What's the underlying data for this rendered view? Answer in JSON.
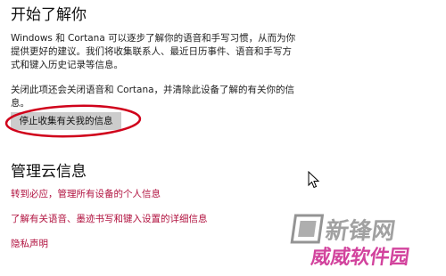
{
  "get_to_know": {
    "title": "开始了解你",
    "description": "Windows 和 Cortana 可以逐步了解你的语音和手写习惯，从而为你提供更好的建议。我们将收集联系人、最近日历事件、语音和手写方式和键入历史记录等信息。",
    "off_note": "关闭此项还会关闭语音和 Cortana，并清除此设备了解的有关你的信息。",
    "stop_button_label": "停止收集有关我的信息"
  },
  "cloud_info": {
    "title": "管理云信息",
    "links": [
      "转到必应，管理所有设备的个人信息",
      "了解有关语音、墨迹书写和键入设置的详细信息",
      "隐私声明"
    ]
  },
  "watermark": {
    "text": "新锋网",
    "sub_text": "威威软件园"
  },
  "colors": {
    "link": "#b1123f",
    "annotation": "#d0021b",
    "button_bg": "#cccccc"
  }
}
